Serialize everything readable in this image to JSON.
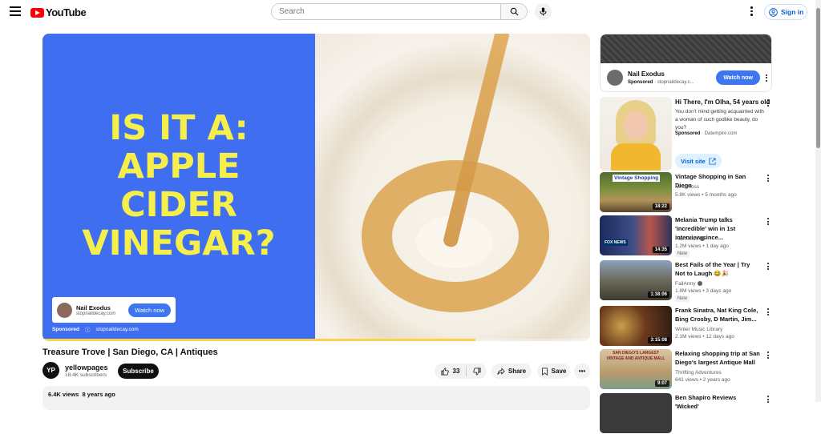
{
  "masthead": {
    "logo_text": "YouTube",
    "search_placeholder": "Search",
    "signin_label": "Sign in"
  },
  "player": {
    "headline_lines": [
      "IS IT A:",
      "APPLE",
      "CIDER",
      "VINEGAR?"
    ],
    "ad_card": {
      "name": "Nail Exodus",
      "site": "stopnaildecay.com",
      "watch_label": "Watch now"
    },
    "ad_footer": {
      "sponsored": "Sponsored",
      "site": "stopnaildecay.com"
    },
    "progress_fraction": 0.79,
    "colors": {
      "blue": "#3f6ef0",
      "yellow": "#f6ef4b"
    }
  },
  "video": {
    "title": "Treasure Trove | San Diego, CA | Antiques",
    "channel": "yellowpages",
    "channel_avatar_text": "YP",
    "subscribers": "18.4K subscribers",
    "subscribe_label": "Subscribe",
    "likes": "33",
    "share_label": "Share",
    "save_label": "Save",
    "views": "6.4K views",
    "age": "8 years ago"
  },
  "sidebar": {
    "sponsor_card": {
      "title": "Nail Exodus",
      "sponsored": "Sponsored",
      "site": "stopnaildecay.c...",
      "watch_label": "Watch now"
    },
    "ad2": {
      "title": "Hi There, I'm Olha, 54 years old",
      "desc": "You don't mind getting acquainted with a woman of such godlike beauty, do you?",
      "sponsored": "Sponsored",
      "site": "Datempire.com",
      "visit_label": "Visit site"
    },
    "videos": [
      {
        "title": "Vintage Shopping in San Diego",
        "channel": "Nina Ross",
        "meta": "5.8K views • 5 months ago",
        "duration": "18:22",
        "verified": false,
        "new": false
      },
      {
        "title": "Melania Trump talks 'incredible' win in 1st interview since...",
        "channel": "Fox News",
        "meta": "1.2M views • 1 day ago",
        "duration": "14:35",
        "verified": true,
        "new": true
      },
      {
        "title": "Best Fails of the Year | Try Not to Laugh 😂🎉",
        "channel": "FailArmy",
        "meta": "1.8M views • 3 days ago",
        "duration": "1:38:06",
        "verified": true,
        "new": true
      },
      {
        "title": "Frank Sinatra, Nat King Cole, Bing Crosby, D Martin, Jim...",
        "channel": "Winter Music Library",
        "meta": "2.1M views • 12 days ago",
        "duration": "3:15:08",
        "verified": false,
        "new": false
      },
      {
        "title": "Relaxing shopping trip at San Diego's largest Antique Mall",
        "channel": "Thrifting Adventures",
        "meta": "641 views • 2 years ago",
        "duration": "9:07",
        "verified": false,
        "new": false
      },
      {
        "title": "Ben Shapiro Reviews 'Wicked'",
        "channel": "",
        "meta": "",
        "duration": "",
        "verified": false,
        "new": false
      }
    ],
    "thumb_texts": {
      "v0": "Vintage Shopping",
      "v1": "FOX NEWS",
      "v4": "SAN DIEGO'S LARGEST VINTAGE AND ANTIQUE MALL"
    }
  }
}
